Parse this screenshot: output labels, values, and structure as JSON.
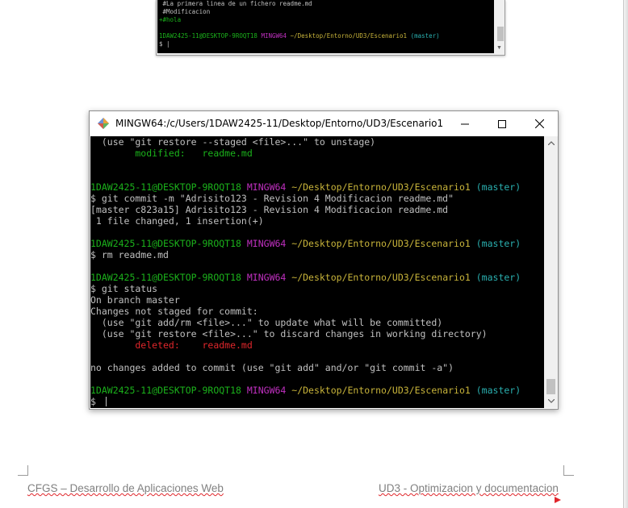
{
  "top_terminal": {
    "lines": [
      {
        "segments": [
          {
            "text": " #La primera linea de un fichero readme.md",
            "color": "default"
          }
        ]
      },
      {
        "segments": [
          {
            "text": " #Modificacion",
            "color": "default"
          }
        ]
      },
      {
        "segments": [
          {
            "text": "+#hola",
            "color": "green"
          }
        ]
      },
      {
        "segments": [
          {
            "text": "",
            "color": "default"
          }
        ]
      },
      {
        "segments": [
          {
            "text": "1DAW2425-11@DESKTOP-9ROQT18 ",
            "color": "green"
          },
          {
            "text": "MINGW64 ",
            "color": "magenta"
          },
          {
            "text": "~/Desktop/Entorno/UD3/Escenario1 ",
            "color": "yellow"
          },
          {
            "text": "(master)",
            "color": "cyan"
          }
        ]
      },
      {
        "segments": [
          {
            "text": "$ |",
            "color": "default"
          }
        ]
      }
    ]
  },
  "window": {
    "title": "MINGW64:/c/Users/1DAW2425-11/Desktop/Entorno/UD3/Escenario1",
    "controls": {
      "minimize": "minimize",
      "maximize": "maximize",
      "close": "close"
    }
  },
  "terminal": {
    "lines": [
      {
        "segments": [
          {
            "text": "  (use \"git restore --staged <file>...\" to unstage)",
            "color": "default"
          }
        ]
      },
      {
        "segments": [
          {
            "text": "        modified:   readme.md",
            "color": "green"
          }
        ]
      },
      {
        "segments": [
          {
            "text": "",
            "color": "default"
          }
        ]
      },
      {
        "segments": [
          {
            "text": "",
            "color": "default"
          }
        ]
      },
      {
        "segments": [
          {
            "text": "1DAW2425-11@DESKTOP-9ROQT18 ",
            "color": "green"
          },
          {
            "text": "MINGW64 ",
            "color": "magenta"
          },
          {
            "text": "~/Desktop/Entorno/UD3/Escenario1 ",
            "color": "yellow"
          },
          {
            "text": "(master)",
            "color": "cyan"
          }
        ]
      },
      {
        "segments": [
          {
            "text": "$ git commit -m \"Adrisito123 - Revision 4 Modificacion readme.md\"",
            "color": "default"
          }
        ]
      },
      {
        "segments": [
          {
            "text": "[master c823a15] Adrisito123 - Revision 4 Modificacion readme.md",
            "color": "default"
          }
        ]
      },
      {
        "segments": [
          {
            "text": " 1 file changed, 1 insertion(+)",
            "color": "default"
          }
        ]
      },
      {
        "segments": [
          {
            "text": "",
            "color": "default"
          }
        ]
      },
      {
        "segments": [
          {
            "text": "1DAW2425-11@DESKTOP-9ROQT18 ",
            "color": "green"
          },
          {
            "text": "MINGW64 ",
            "color": "magenta"
          },
          {
            "text": "~/Desktop/Entorno/UD3/Escenario1 ",
            "color": "yellow"
          },
          {
            "text": "(master)",
            "color": "cyan"
          }
        ]
      },
      {
        "segments": [
          {
            "text": "$ rm readme.md",
            "color": "default"
          }
        ]
      },
      {
        "segments": [
          {
            "text": "",
            "color": "default"
          }
        ]
      },
      {
        "segments": [
          {
            "text": "1DAW2425-11@DESKTOP-9ROQT18 ",
            "color": "green"
          },
          {
            "text": "MINGW64 ",
            "color": "magenta"
          },
          {
            "text": "~/Desktop/Entorno/UD3/Escenario1 ",
            "color": "yellow"
          },
          {
            "text": "(master)",
            "color": "cyan"
          }
        ]
      },
      {
        "segments": [
          {
            "text": "$ git status",
            "color": "default"
          }
        ]
      },
      {
        "segments": [
          {
            "text": "On branch master",
            "color": "default"
          }
        ]
      },
      {
        "segments": [
          {
            "text": "Changes not staged for commit:",
            "color": "default"
          }
        ]
      },
      {
        "segments": [
          {
            "text": "  (use \"git add/rm <file>...\" to update what will be committed)",
            "color": "default"
          }
        ]
      },
      {
        "segments": [
          {
            "text": "  (use \"git restore <file>...\" to discard changes in working directory)",
            "color": "default"
          }
        ]
      },
      {
        "segments": [
          {
            "text": "        deleted:    readme.md",
            "color": "red"
          }
        ]
      },
      {
        "segments": [
          {
            "text": "",
            "color": "default"
          }
        ]
      },
      {
        "segments": [
          {
            "text": "no changes added to commit (use \"git add\" and/or \"git commit -a\")",
            "color": "default"
          }
        ]
      },
      {
        "segments": [
          {
            "text": "",
            "color": "default"
          }
        ]
      },
      {
        "segments": [
          {
            "text": "1DAW2425-11@DESKTOP-9ROQT18 ",
            "color": "green"
          },
          {
            "text": "MINGW64 ",
            "color": "magenta"
          },
          {
            "text": "~/Desktop/Entorno/UD3/Escenario1 ",
            "color": "yellow"
          },
          {
            "text": "(master)",
            "color": "cyan"
          }
        ]
      },
      {
        "segments": [
          {
            "text": "$ ",
            "color": "default"
          }
        ],
        "cursor": true
      }
    ]
  },
  "footer": {
    "left_text": "CFGS – Desarrollo de Aplicaciones Web",
    "right_text": "UD3 - Optimizacion y documentacion"
  },
  "colors": {
    "terminal_bg": "#000000",
    "default": "#c0c0c0",
    "green": "#1bb21b",
    "magenta": "#c030c0",
    "yellow": "#c8b43a",
    "cyan": "#2ab0b0",
    "red": "#e0262b"
  },
  "icons": {
    "window_icon": "git-diamond-icon",
    "minimize": "minimize-icon",
    "maximize": "maximize-icon",
    "close": "close-icon",
    "scroll_up": "chevron-up-icon",
    "scroll_down": "chevron-down-icon",
    "footer_marker": "red-triangle-icon"
  }
}
